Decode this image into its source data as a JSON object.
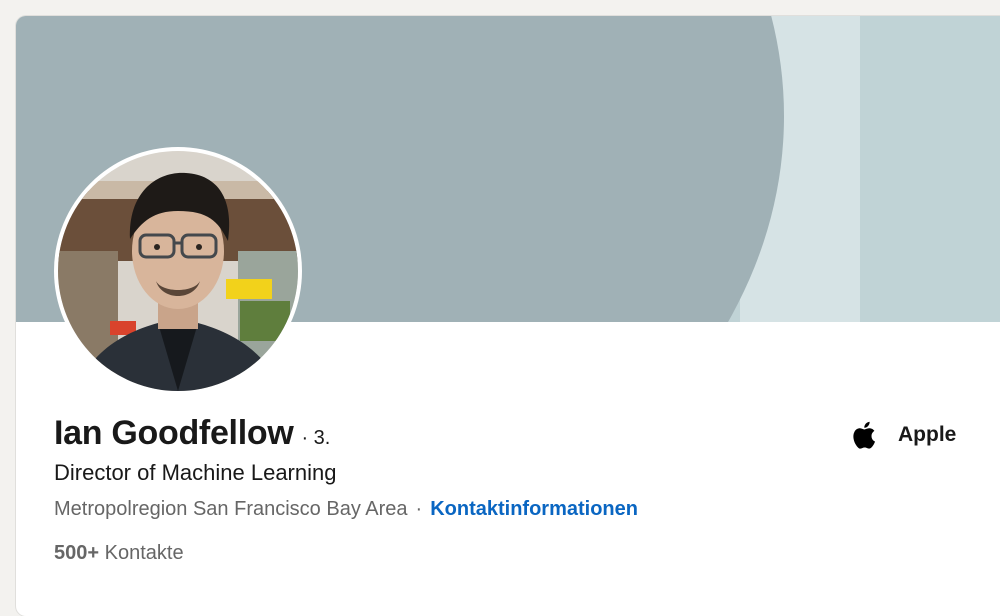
{
  "profile": {
    "name": "Ian Goodfellow",
    "degree": "· 3.",
    "headline": "Director of Machine Learning",
    "location": "Metropolregion San Francisco Bay Area",
    "separator": "·",
    "contact_link": "Kontaktinformationen",
    "connections_count": "500+",
    "connections_label": "Kontakte"
  },
  "company": {
    "name": "Apple",
    "logo_icon": "apple-logo-icon"
  },
  "colors": {
    "link": "#0a66c2",
    "banner_dark": "#a0b1b6",
    "banner_light": "#c0d3d6"
  }
}
